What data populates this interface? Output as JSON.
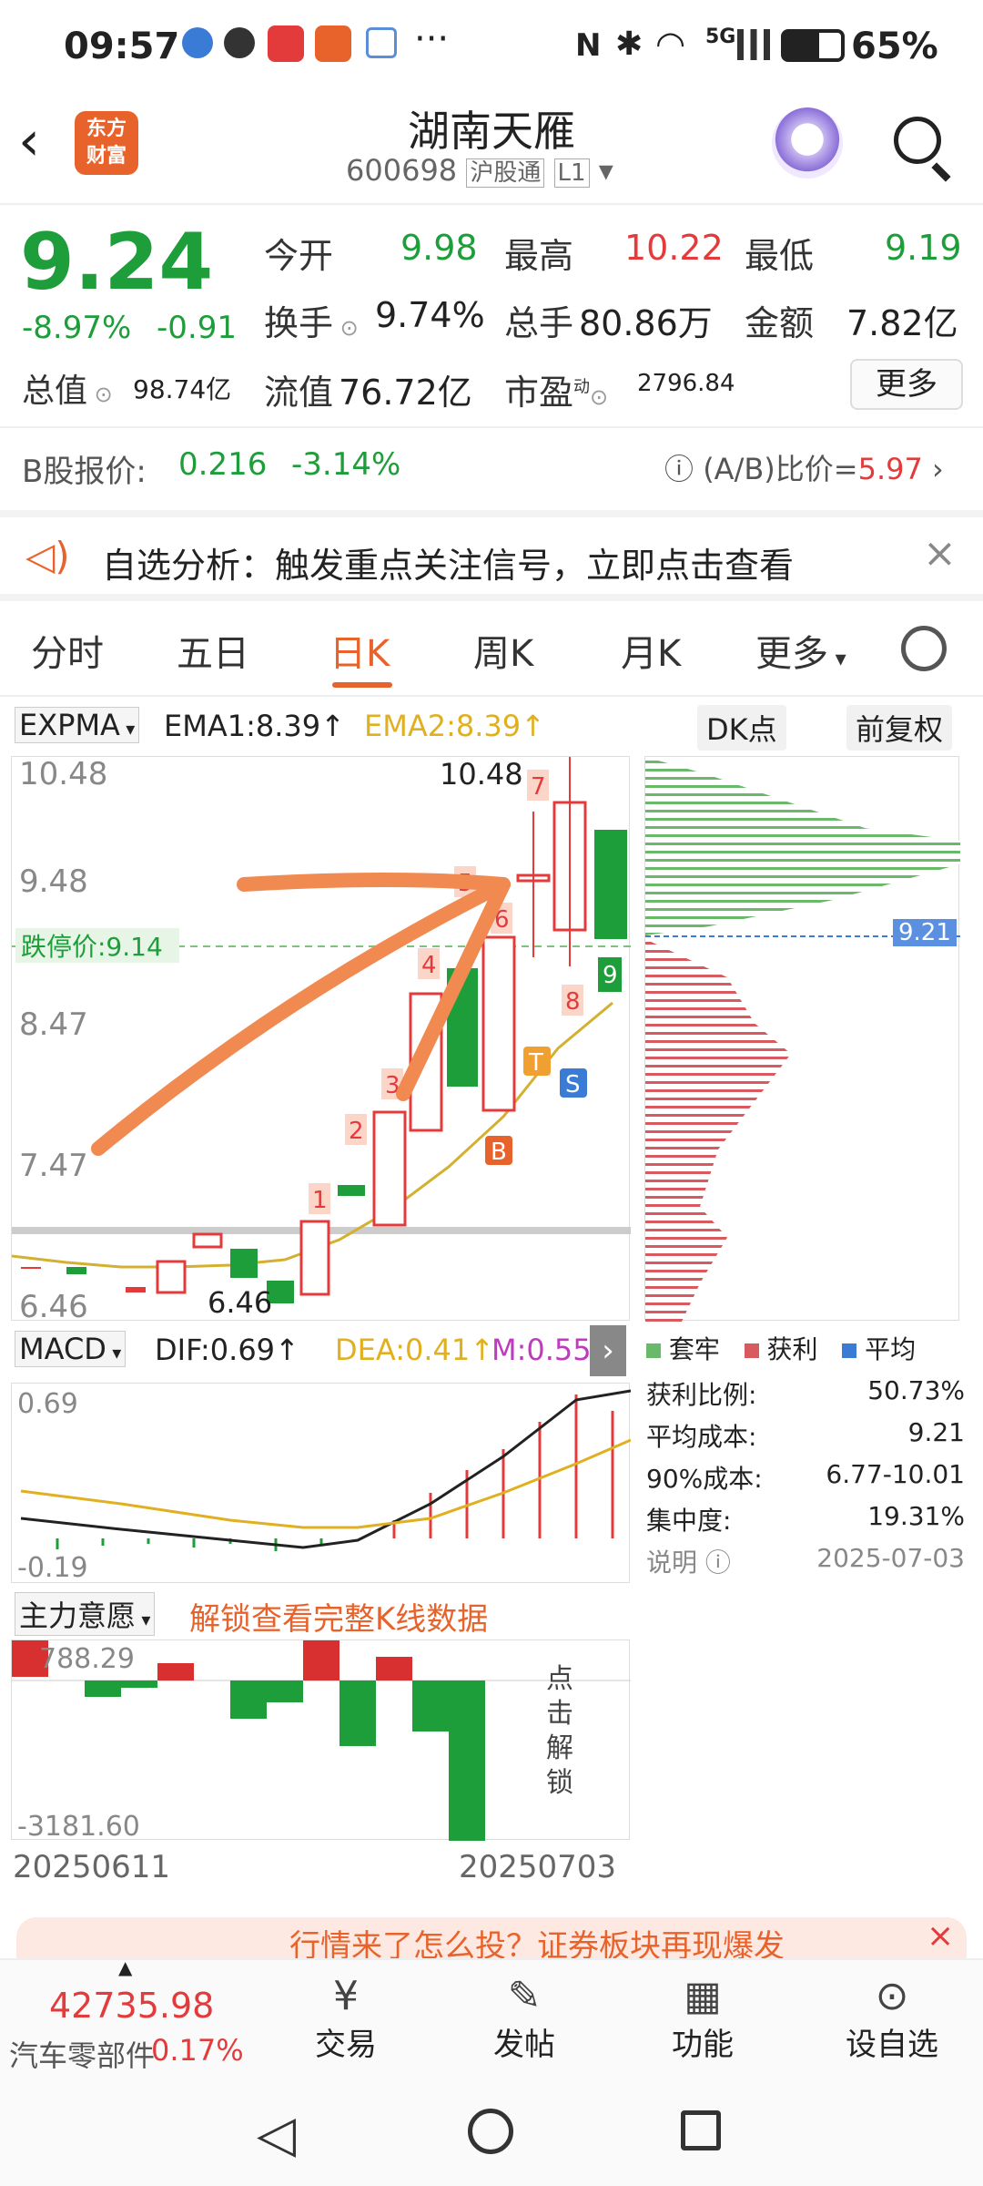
{
  "status": {
    "time": "09:57",
    "signal_icons": "5G",
    "battery": "65%"
  },
  "header": {
    "title": "湖南天雁",
    "code": "600698",
    "tag1": "沪股通",
    "tag2": "L1",
    "logo_text": "东方\n财富"
  },
  "quote": {
    "price": "9.24",
    "change_pct": "-8.97%",
    "change": "-0.91",
    "open_label": "今开",
    "open": "9.98",
    "high_label": "最高",
    "high": "10.22",
    "low_label": "最低",
    "low": "9.19",
    "turnover_label": "换手",
    "turnover": "9.74%",
    "volume_label": "总手",
    "volume": "80.86万",
    "amount_label": "金额",
    "amount": "7.82亿",
    "mktcap_label": "总值",
    "mktcap": "98.74亿",
    "float_label": "流值",
    "float": "76.72亿",
    "pe_label": "市盈",
    "pe_sup": "动",
    "pe": "2796.84",
    "more": "更多"
  },
  "bshare": {
    "label": "B股报价:",
    "price": "0.216",
    "pct": "-3.14%",
    "ratio_label": "(A/B)比价=",
    "ratio": "5.97"
  },
  "banner": {
    "text": "自选分析：触发重点关注信号，立即点击查看"
  },
  "tabs": [
    "分时",
    "五日",
    "日K",
    "周K",
    "月K",
    "更多"
  ],
  "active_tab": "日K",
  "indicator": {
    "name": "EXPMA",
    "ema1": "EMA1:8.39",
    "ema2": "EMA2:8.39",
    "dk": "DK点",
    "adj": "前复权"
  },
  "kchart": {
    "y_labels": [
      "10.48",
      "9.48",
      "8.47",
      "7.47",
      "6.46"
    ],
    "limit_down": "跌停价:9.14",
    "high_mark": "10.48",
    "low_mark": "6.46",
    "cost_label": "9.21",
    "signals": [
      "1",
      "2",
      "3",
      "4",
      "5",
      "6",
      "7",
      "8",
      "9"
    ],
    "marker_b": "B",
    "marker_t": "T",
    "marker_s": "S"
  },
  "macd": {
    "name": "MACD",
    "dif": "DIF:0.69",
    "dea": "DEA:0.41",
    "m": "M:0.55",
    "top": "0.69",
    "bottom": "-0.19"
  },
  "zhuli": {
    "name": "主力意愿",
    "unlock": "解锁查看完整K线数据",
    "top": "788.29",
    "bottom": "-3181.60",
    "unlock_btn": "点击解锁"
  },
  "dates": {
    "start": "20250611",
    "end": "20250703"
  },
  "chip": {
    "legend": [
      "套牢",
      "获利",
      "平均"
    ],
    "rows": [
      {
        "k": "获利比例:",
        "v": "50.73%"
      },
      {
        "k": "平均成本:",
        "v": "9.21"
      },
      {
        "k": "90%成本:",
        "v": "6.77-10.01"
      },
      {
        "k": "集中度:",
        "v": "19.31%"
      }
    ],
    "note": "说明",
    "date": "2025-07-03"
  },
  "ad": {
    "text": "行情来了怎么投？证券板块再现爆发"
  },
  "bottom": {
    "index_val": "42735.98",
    "index_name": "汽车零部件",
    "index_pct": "0.17%",
    "items": [
      "交易",
      "发帖",
      "功能",
      "设自选"
    ]
  },
  "colors": {
    "up": "#e33b3b",
    "down": "#1e9e3a",
    "accent": "#e8632b"
  }
}
